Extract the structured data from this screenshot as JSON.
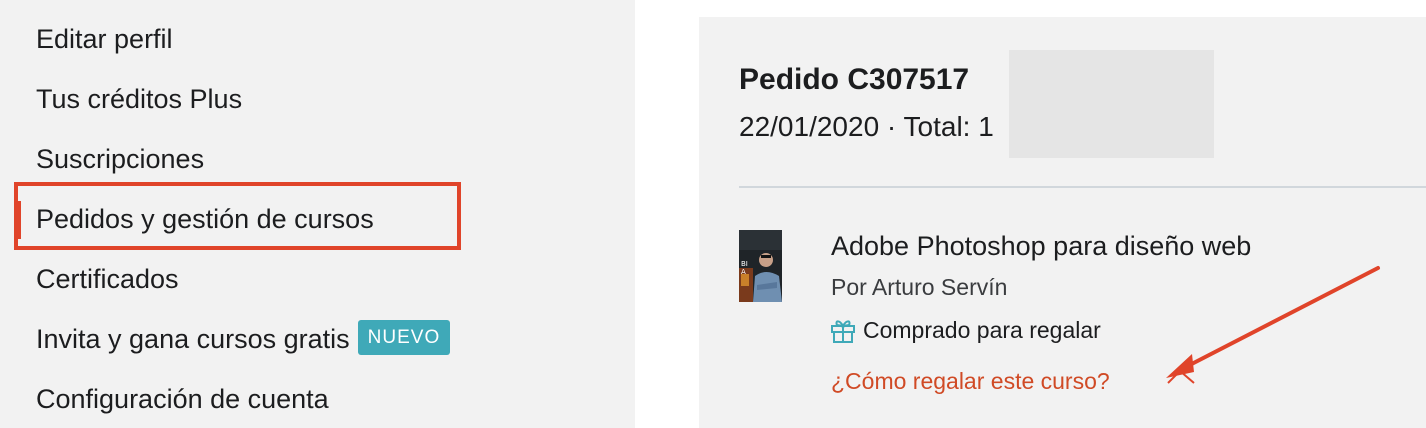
{
  "sidebar": {
    "items": [
      {
        "label": "Editar perfil"
      },
      {
        "label": "Tus créditos Plus"
      },
      {
        "label": "Suscripciones"
      },
      {
        "label": "Pedidos y gestión de cursos",
        "active": true
      },
      {
        "label": "Certificados"
      },
      {
        "label": "Invita y gana cursos gratis",
        "badge": "NUEVO"
      },
      {
        "label": "Configuración de cuenta"
      }
    ]
  },
  "order": {
    "title": "Pedido C307517",
    "meta": "22/01/2020 · Total: 1",
    "course": {
      "title": "Adobe Photoshop para diseño web",
      "author": "Por Arturo Servín",
      "gift_status": "Comprado para regalar",
      "gift_link": "¿Cómo regalar este curso?",
      "thumbnail_icon": "course-thumbnail"
    }
  },
  "colors": {
    "annotation": "#e0442a",
    "badge": "#3fa9b8",
    "link": "#d04a25",
    "gift_icon": "#3fa9b8"
  }
}
